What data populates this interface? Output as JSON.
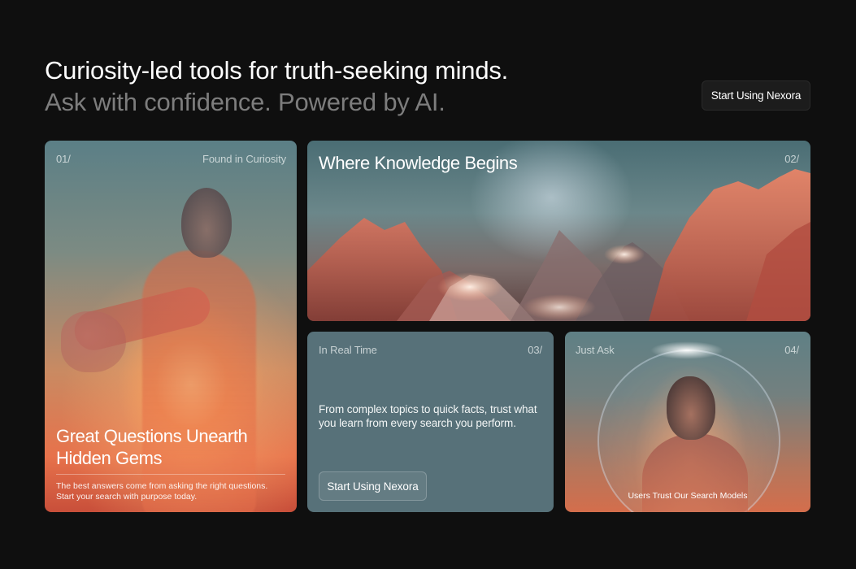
{
  "header": {
    "title": "Curiosity-led tools for truth-seeking minds.",
    "subtitle": "Ask with confidence. Powered by AI.",
    "cta_label": "Start Using Nexora"
  },
  "cards": [
    {
      "number": "01/",
      "tag": "Found in Curiosity",
      "headline": "Great Questions Unearth Hidden Gems",
      "description": "The best answers come from asking the right questions. Start your search with purpose today."
    },
    {
      "number": "02/",
      "headline": "Where Knowledge Begins"
    },
    {
      "number": "03/",
      "tag": "In Real Time",
      "body": "From complex topics to quick facts, trust what you learn from every search you perform.",
      "cta_label": "Start Using Nexora"
    },
    {
      "number": "04/",
      "tag": "Just Ask",
      "caption": "Users Trust Our Search Models"
    }
  ]
}
